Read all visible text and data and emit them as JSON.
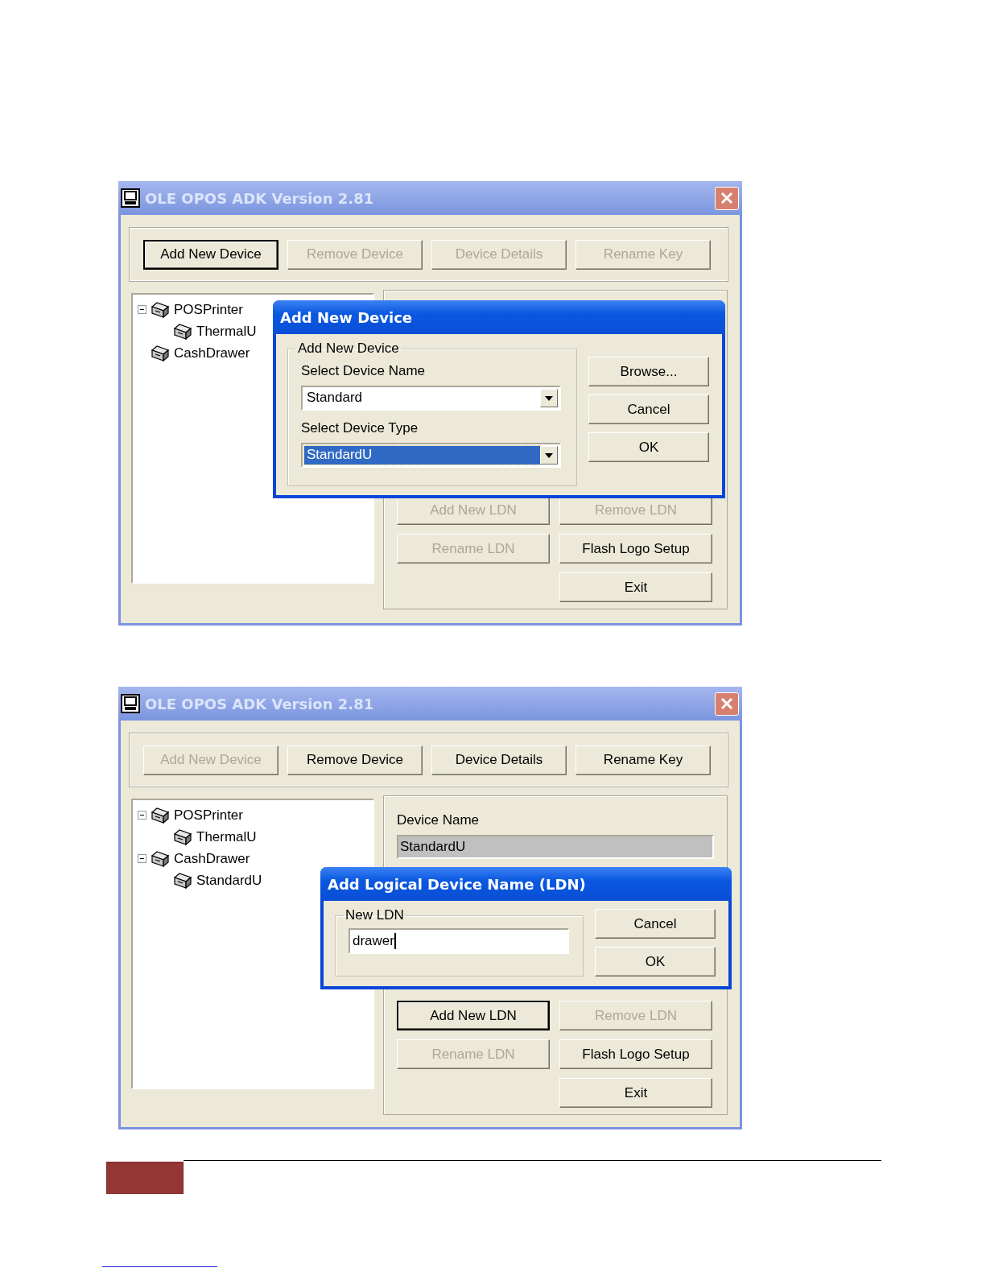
{
  "windows": [
    {
      "title": "OLE OPOS ADK Version 2.81",
      "toolbar": [
        {
          "label": "Add New Device",
          "disabled": false,
          "default": true
        },
        {
          "label": "Remove Device",
          "disabled": true,
          "default": false
        },
        {
          "label": "Device Details",
          "disabled": true,
          "default": false
        },
        {
          "label": "Rename Key",
          "disabled": true,
          "default": false
        }
      ],
      "tree": [
        {
          "label": "POSPrinter",
          "expanded": true,
          "children": [
            {
              "label": "ThermalU"
            }
          ]
        },
        {
          "label": "CashDrawer"
        }
      ],
      "ldn_buttons": [
        {
          "label": "Add New LDN",
          "disabled": true,
          "default": false
        },
        {
          "label": "Remove LDN",
          "disabled": true,
          "default": false
        },
        {
          "label": "Rename LDN",
          "disabled": true,
          "default": false
        },
        {
          "label": "Flash Logo Setup",
          "disabled": false,
          "default": false
        },
        {
          "label": "Exit",
          "disabled": false,
          "default": false
        }
      ],
      "dialog": {
        "kind": "add_device",
        "title": "Add New Device",
        "group": "Add New Device",
        "fields": [
          {
            "label": "Select Device Name",
            "value": "Standard",
            "selected": false
          },
          {
            "label": "Select Device Type",
            "value": "StandardU",
            "selected": true
          }
        ],
        "buttons": [
          "Browse...",
          "Cancel",
          "OK"
        ]
      }
    },
    {
      "title": "OLE OPOS ADK Version 2.81",
      "toolbar": [
        {
          "label": "Add New Device",
          "disabled": true,
          "default": false
        },
        {
          "label": "Remove Device",
          "disabled": false,
          "default": false
        },
        {
          "label": "Device Details",
          "disabled": false,
          "default": false
        },
        {
          "label": "Rename Key",
          "disabled": false,
          "default": false
        }
      ],
      "tree": [
        {
          "label": "POSPrinter",
          "expanded": true,
          "children": [
            {
              "label": "ThermalU"
            }
          ]
        },
        {
          "label": "CashDrawer",
          "expanded": true,
          "children": [
            {
              "label": "StandardU"
            }
          ]
        }
      ],
      "device_name": {
        "label": "Device Name",
        "value": "StandardU"
      },
      "ldn_buttons": [
        {
          "label": "Add New LDN",
          "disabled": false,
          "default": true
        },
        {
          "label": "Remove LDN",
          "disabled": true,
          "default": false
        },
        {
          "label": "Rename LDN",
          "disabled": true,
          "default": false
        },
        {
          "label": "Flash Logo Setup",
          "disabled": false,
          "default": false
        },
        {
          "label": "Exit",
          "disabled": false,
          "default": false
        }
      ],
      "dialog": {
        "kind": "add_ldn",
        "title": "Add Logical Device Name (LDN)",
        "group": "New LDN",
        "input": {
          "value": "drawer",
          "focused": true
        },
        "buttons": [
          "Cancel",
          "OK"
        ]
      }
    }
  ]
}
